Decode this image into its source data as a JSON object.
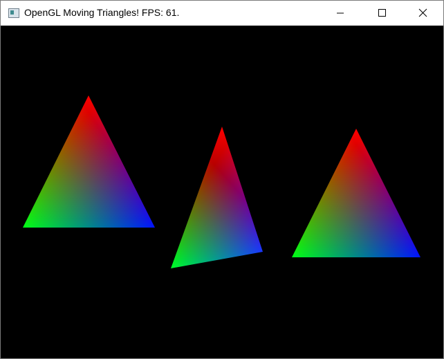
{
  "window": {
    "title": "OpenGL Moving Triangles! FPS: 61.",
    "icon": "app-window-icon",
    "controls": {
      "minimize_icon": "minimize-icon",
      "maximize_icon": "maximize-icon",
      "close_icon": "close-icon"
    }
  },
  "scene": {
    "background_color": "#000000",
    "vertex_colors": [
      "#ff0000",
      "#00ff00",
      "#0000ff"
    ],
    "triangle_count": 3
  }
}
